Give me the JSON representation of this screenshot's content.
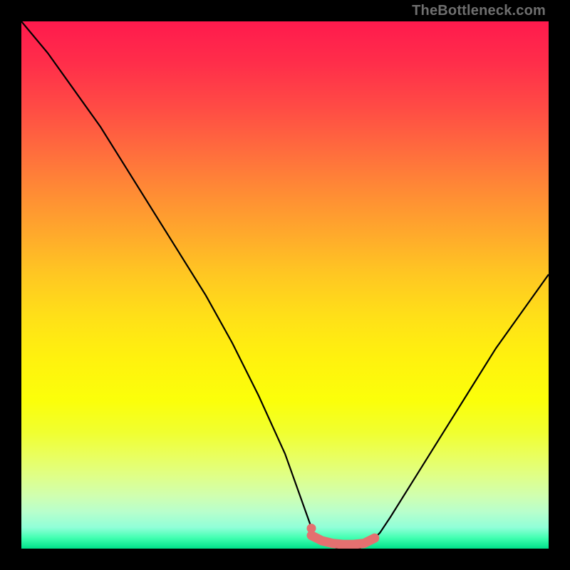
{
  "watermark": "TheBottleneck.com",
  "chart_data": {
    "type": "line",
    "title": "",
    "xlabel": "",
    "ylabel": "",
    "ylim": [
      0,
      100
    ],
    "series": [
      {
        "name": "bottleneck-curve",
        "x": [
          0,
          5,
          10,
          15,
          20,
          25,
          30,
          35,
          40,
          45,
          50,
          55,
          56,
          58,
          60,
          62,
          64,
          66,
          68,
          70,
          75,
          80,
          85,
          90,
          95,
          100
        ],
        "values": [
          100,
          94,
          87,
          80,
          72,
          64,
          56,
          48,
          39,
          29,
          18,
          4,
          2,
          1,
          0,
          0,
          0,
          1,
          3,
          6,
          14,
          22,
          30,
          38,
          45,
          52
        ]
      },
      {
        "name": "optimal-range-highlight",
        "x": [
          55,
          57,
          59,
          61,
          63,
          65,
          67
        ],
        "values": [
          2.5,
          1.5,
          1,
          0.8,
          0.8,
          1,
          2
        ]
      }
    ],
    "colors": {
      "curve": "#000000",
      "highlight": "#e47070",
      "gradient_top": "#ff1a4d",
      "gradient_bottom": "#00e08a"
    }
  }
}
